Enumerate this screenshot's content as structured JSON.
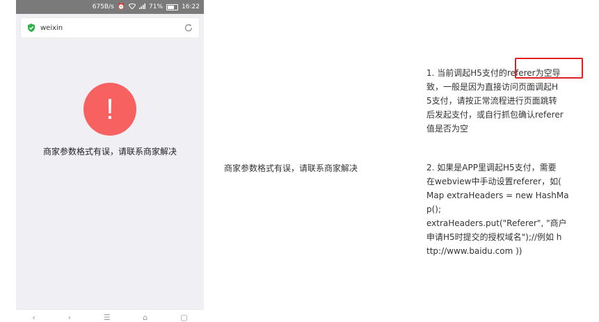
{
  "statusbar": {
    "speed": "675B/s",
    "battery_pct": "71%",
    "time": "16:22"
  },
  "browser": {
    "address": "weixin",
    "icons": {
      "secure": "shield-check-icon",
      "refresh": "refresh-icon"
    }
  },
  "page": {
    "error_icon": "!",
    "error_message": "商家参数格式有误，请联系商家解决",
    "colors": {
      "error_circle": "#f76260"
    }
  },
  "navbar": {
    "items": [
      "back-icon",
      "forward-icon",
      "menu-icon",
      "home-icon",
      "tabs-icon"
    ]
  },
  "middle": {
    "text": "商家参数格式有误，请联系商家解决"
  },
  "notes": {
    "item1_lines": [
      "1. 当前调起H5支付的referer为空导",
      "致，一般是因为直接访问页面调起H",
      "5支付，请按正常流程进行页面跳转",
      "后发起支付，或自行抓包确认referer",
      "值是否为空"
    ],
    "item2_lines": [
      "2. 如果是APP里调起H5支付，需要",
      "在webview中手动设置referer，如(",
      "Map extraHeaders = new HashMa",
      "p();",
      "extraHeaders.put(\"Referer\", \"商户",
      "申请H5时提交的授权域名\");//例如 h",
      "ttp://www.baidu.com ))"
    ],
    "highlight_color": "#e02020"
  }
}
